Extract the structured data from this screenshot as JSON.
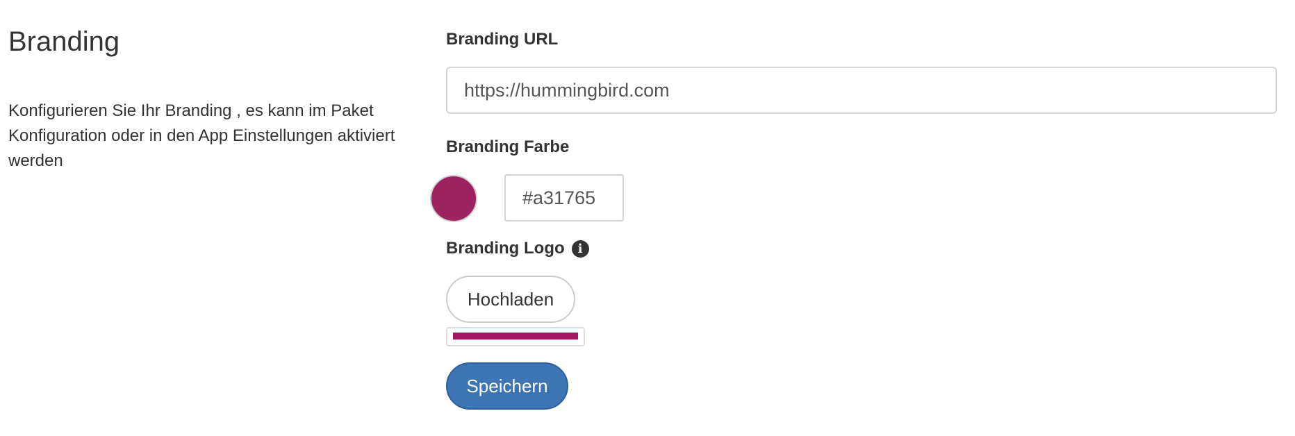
{
  "section": {
    "title": "Branding",
    "description": "Konfigurieren Sie Ihr Branding , es kann im Paket Konfiguration oder in den App Einstellungen aktiviert werden"
  },
  "form": {
    "url_label": "Branding URL",
    "url_value": "https://hummingbird.com",
    "color_label": "Branding Farbe",
    "color_value": "#a31765",
    "logo_label": "Branding Logo",
    "logo_info_icon": "info-circle-icon",
    "upload_label": "Hochladen",
    "save_label": "Speichern"
  },
  "colors": {
    "brand": "#a31765",
    "swatch": "#9c2260",
    "primary_button": "#3d74b3"
  }
}
